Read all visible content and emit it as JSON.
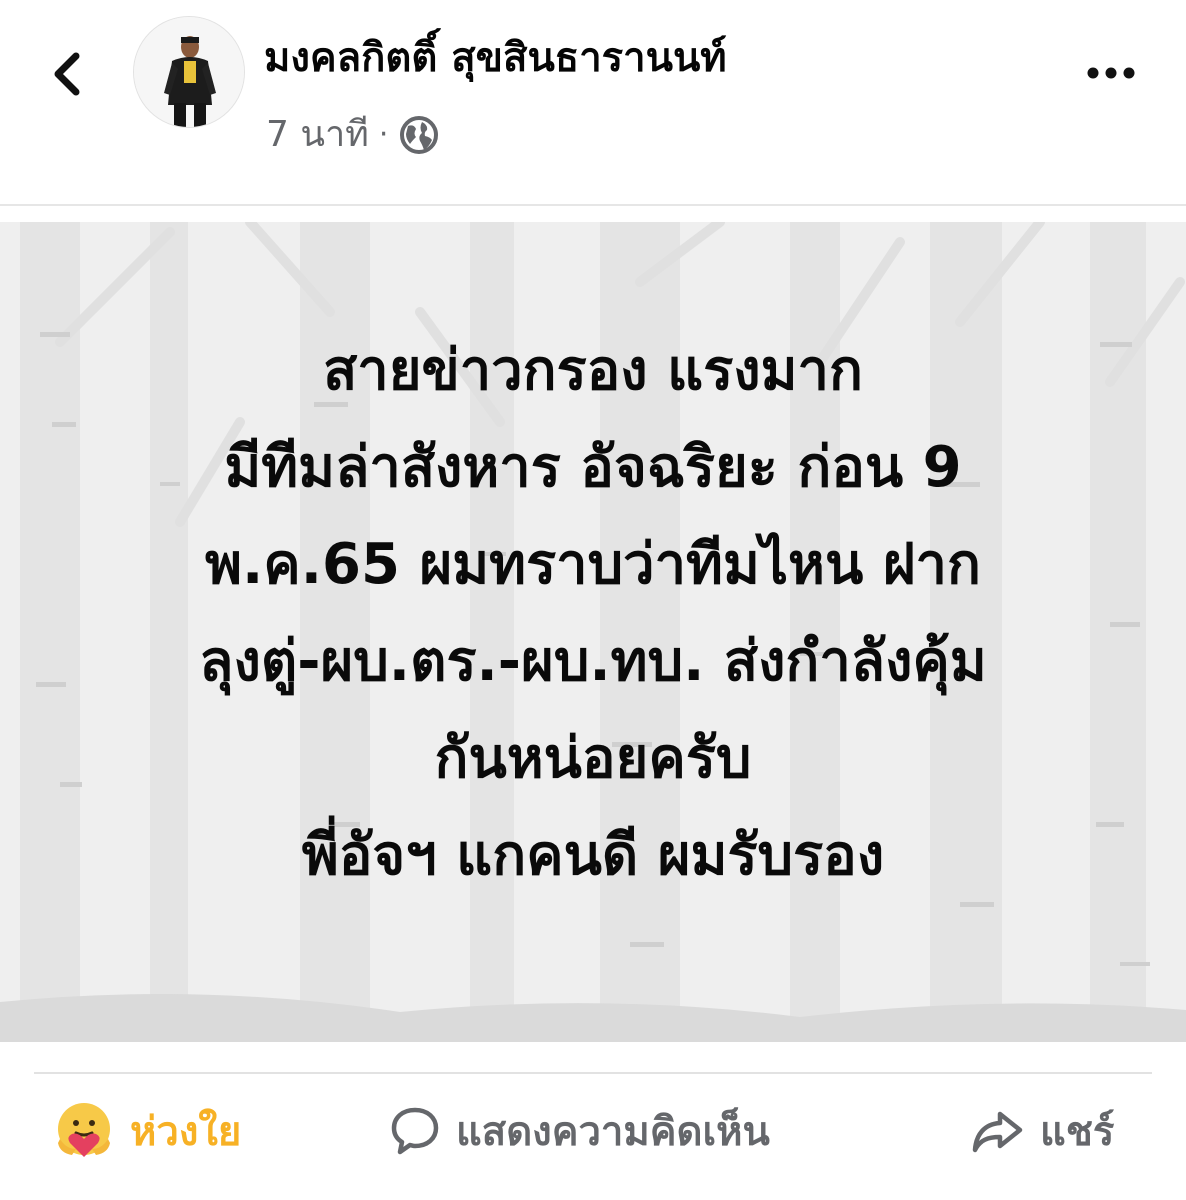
{
  "header": {
    "author_name": "มงคลกิตติ์ สุขสินธารานนท์",
    "timestamp": "7 นาที",
    "separator": "·",
    "back_icon": "chevron-left-icon",
    "privacy_icon": "globe-icon",
    "more_icon": "more-horizontal-icon"
  },
  "post": {
    "lines": [
      "สายข่าวกรอง แรงมาก",
      "มีทีมล่าสังหาร  อัจฉริยะ ก่อน 9",
      "พ.ค.65 ผมทราบว่าทีมไหน ฝาก",
      "ลุงตู่-ผบ.ตร.-ผบ.ทบ. ส่งกำลังคุ้ม",
      "กันหน่อยครับ",
      "พี่อัจฯ แกคนดี ผมรับรอง"
    ],
    "background_color": "#efefef",
    "text_color": "#0a0a0a"
  },
  "actions": {
    "care_label": "ห่วงใย",
    "care_color": "#f7b125",
    "comment_label": "แสดงความคิดเห็น",
    "share_label": "แชร์",
    "icon_color": "#65676b"
  }
}
